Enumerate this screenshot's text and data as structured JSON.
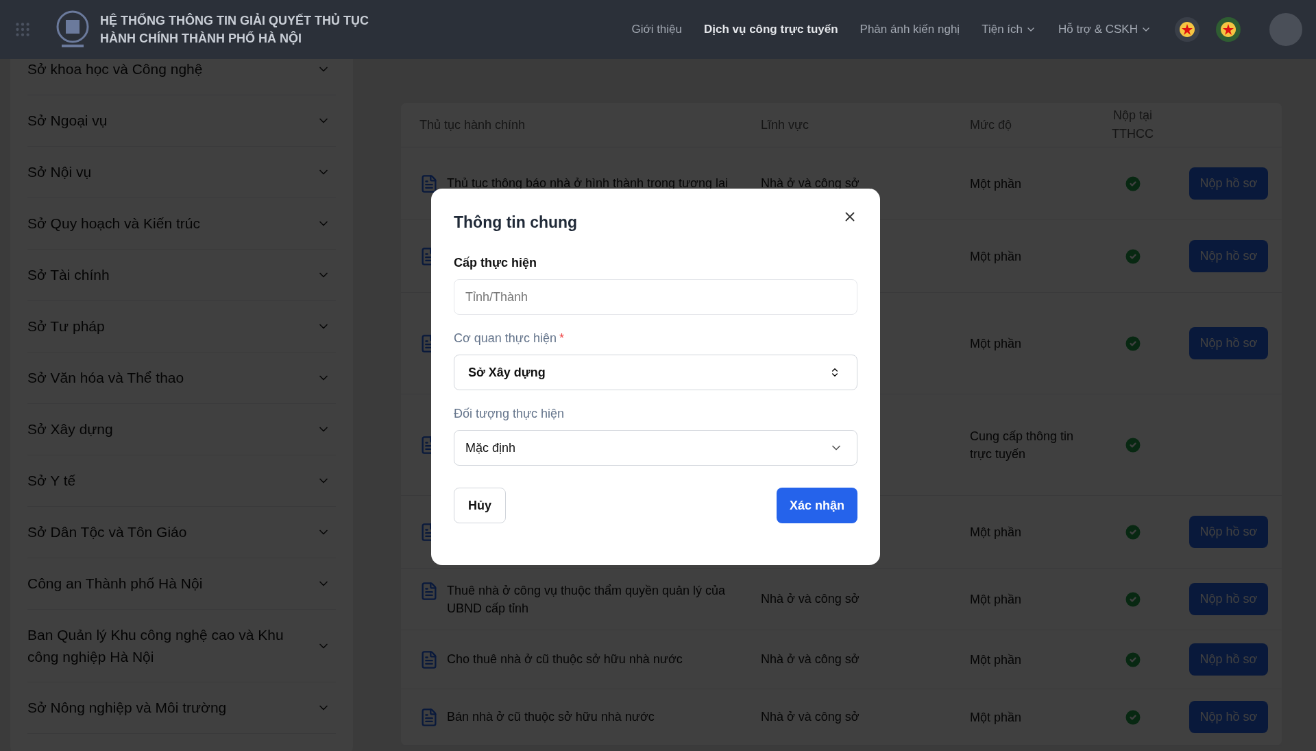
{
  "header": {
    "title_lines": [
      "HỆ THỐNG THÔNG TIN GIẢI QUYẾT THỦ TỤC",
      "HÀNH CHÍNH THÀNH PHỐ HÀ NỘI"
    ],
    "nav": [
      {
        "label": "Giới thiệu",
        "selected": false,
        "has_menu": false
      },
      {
        "label": "Dịch vụ công trực tuyến",
        "selected": true,
        "has_menu": false
      },
      {
        "label": "Phản ánh kiến nghị",
        "selected": false,
        "has_menu": false
      },
      {
        "label": "Tiện ích",
        "selected": false,
        "has_menu": true
      },
      {
        "label": "Hỗ trợ & CSKH",
        "selected": false,
        "has_menu": true
      }
    ]
  },
  "sidebar": {
    "items": [
      {
        "label": "Sở khoa học và Công nghệ",
        "expanded": false
      },
      {
        "label": "Sở Ngoại vụ",
        "expanded": false
      },
      {
        "label": "Sở Nội vụ",
        "expanded": false
      },
      {
        "label": "Sở Quy hoạch và Kiến trúc",
        "expanded": false
      },
      {
        "label": "Sở Tài chính",
        "expanded": false
      },
      {
        "label": "Sở Tư pháp",
        "expanded": false
      },
      {
        "label": "Sở Văn hóa và Thể thao",
        "expanded": false
      },
      {
        "label": "Sở Xây dựng",
        "expanded": false
      },
      {
        "label": "Sở Y tế",
        "expanded": false
      },
      {
        "label": "Sở Dân Tộc và Tôn Giáo",
        "expanded": false
      },
      {
        "label": "Công an Thành phố Hà Nội",
        "expanded": false
      },
      {
        "label": "Ban Quản lý Khu công nghệ cao và Khu công nghiệp Hà Nội",
        "expanded": false
      },
      {
        "label": "Sở Nông nghiệp và Môi trường",
        "expanded": false
      }
    ]
  },
  "table": {
    "columns": [
      "Thủ tục hành chính",
      "Lĩnh vực",
      "Mức độ",
      "Nộp tại TTHCC"
    ],
    "rows": [
      {
        "procedure": "Thủ tục thông báo nhà ở hình thành trong tương lai",
        "field": "Nhà ở và công sở",
        "level": "Một phần",
        "submitted": true,
        "action": "Nộp hồ sơ"
      },
      {
        "level": "Một phần",
        "submitted": true,
        "action": "Nộp hồ sơ"
      },
      {
        "level": "Một phần",
        "submitted": true,
        "action": "Nộp hồ sơ"
      },
      {
        "level": "Cung cấp thông tin trực tuyến",
        "submitted": true
      },
      {
        "level": "Một phần",
        "submitted": true,
        "action": "Nộp hồ sơ"
      },
      {
        "procedure": "Thuê nhà ở công vụ thuộc thẩm quyền quản lý của UBND cấp tỉnh",
        "field": "Nhà ở và công sở",
        "level": "Một phần",
        "submitted": true,
        "action": "Nộp hồ sơ"
      },
      {
        "procedure": "Cho thuê nhà ở cũ thuộc sở hữu nhà nước",
        "field": "Nhà ở và công sở",
        "level": "Một phần",
        "submitted": true,
        "action": "Nộp hồ sơ"
      },
      {
        "procedure": "Bán nhà ở cũ thuộc sở hữu nhà nước",
        "field": "Nhà ở và công sở",
        "level": "Một phần",
        "submitted": true,
        "action": "Nộp hồ sơ"
      }
    ]
  },
  "modal": {
    "title": "Thông tin chung",
    "fields": [
      {
        "kind": "input",
        "label": "Cấp thực hiện",
        "placeholder": "Tỉnh/Thành"
      },
      {
        "kind": "updown",
        "label": "Cơ quan thực hiện",
        "required_mark": "*",
        "value": "Sở Xây dựng"
      },
      {
        "kind": "dropdown",
        "label": "Đối tượng thực hiện",
        "value": "Mặc định"
      }
    ],
    "cancel": "Hủy",
    "confirm": "Xác nhận"
  }
}
